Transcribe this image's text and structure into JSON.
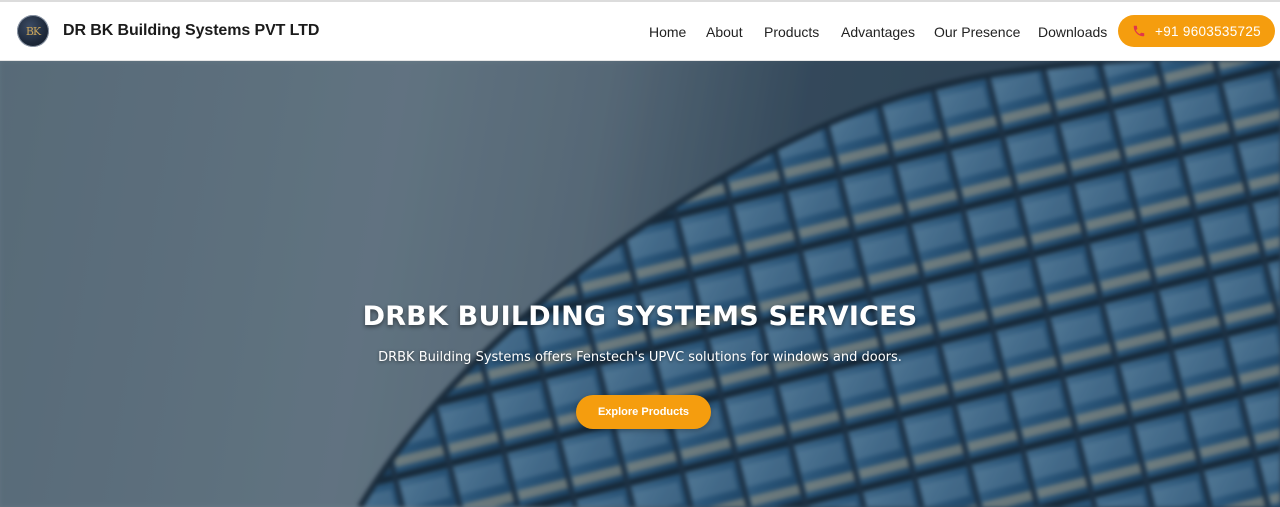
{
  "brand": {
    "logo_text": "BK",
    "name": "DR BK Building Systems PVT LTD"
  },
  "nav": {
    "items": [
      {
        "label": "Home"
      },
      {
        "label": "About"
      },
      {
        "label": "Products"
      },
      {
        "label": "Advantages"
      },
      {
        "label": "Our Presence"
      },
      {
        "label": "Downloads"
      }
    ],
    "phone_icon": "phone-icon",
    "phone": "+91 9603535725"
  },
  "hero": {
    "title": "DRBK BUILDING SYSTEMS SERVICES",
    "subtitle": "DRBK Building Systems offers Fenstech's UPVC solutions for windows and doors.",
    "cta": "Explore Products",
    "background": "blurred-glass-building-photo"
  },
  "colors": {
    "accent": "#f59d0e",
    "header_bg": "#ffffff",
    "text": "#222222"
  }
}
